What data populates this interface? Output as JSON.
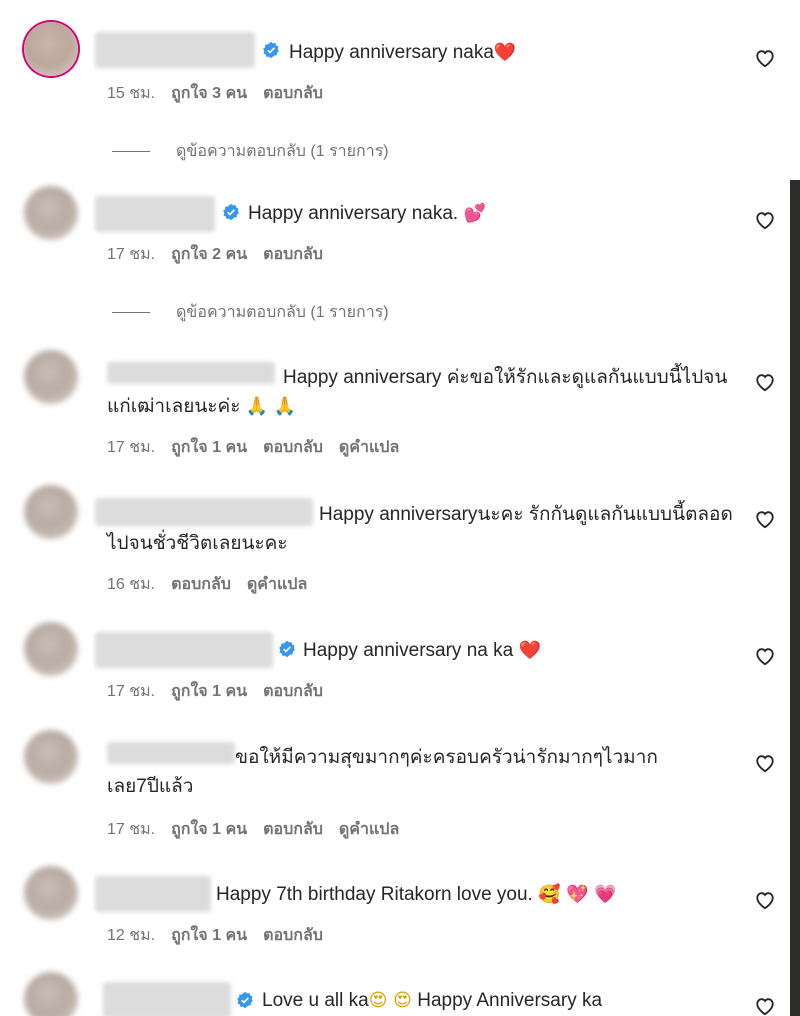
{
  "comments": [
    {
      "text": "Happy anniversary naka",
      "emoji": "❤️",
      "time": "15 ชม.",
      "likes": "ถูกใจ 3 คน",
      "reply": "ตอบกลับ",
      "view_replies": "ดูข้อความตอบกลับ (1 รายการ)"
    },
    {
      "text": "Happy anniversary naka.",
      "emoji": "💕",
      "time": "17 ชม.",
      "likes": "ถูกใจ 2 คน",
      "reply": "ตอบกลับ",
      "view_replies": "ดูข้อความตอบกลับ (1 รายการ)"
    },
    {
      "text": "Happy anniversary ค่ะขอให้รักและดูแลกันแบบนี้ไปจนแก่เฒ่าเลยนะค่ะ",
      "emoji": "🙏 🙏",
      "time": "17 ชม.",
      "likes": "ถูกใจ 1 คน",
      "reply": "ตอบกลับ",
      "translate": "ดูคำแปล"
    },
    {
      "text": "Happy anniversaryนะคะ รักกันดูแลกันแบบนี้ตลอดไปจนชั่วชีวิตเลยนะคะ",
      "time": "16 ชม.",
      "reply": "ตอบกลับ",
      "translate": "ดูคำแปล"
    },
    {
      "text": "Happy anniversary na ka",
      "emoji": "❤️",
      "time": "17 ชม.",
      "likes": "ถูกใจ 1 คน",
      "reply": "ตอบกลับ"
    },
    {
      "text": "ขอให้มีความสุขมากๆค่ะครอบครัวน่ารักมากๆไวมากเลย7ปีแล้ว",
      "time": "17 ชม.",
      "likes": "ถูกใจ 1 คน",
      "reply": "ตอบกลับ",
      "translate": "ดูคำแปล"
    },
    {
      "text": "Happy 7th birthday Ritakorn love you.",
      "emoji": "🥰 💖 💗",
      "time": "12 ชม.",
      "likes": "ถูกใจ 1 คน",
      "reply": "ตอบกลับ"
    },
    {
      "text_a": "Love u all ka",
      "emoji_a": "😍 😍",
      "text_b": "Happy Anniversary ka"
    }
  ],
  "icons": {
    "like": "heart-outline-icon",
    "verified": "verified-badge-icon"
  },
  "colors": {
    "verified": "#3797f0",
    "muted": "#737373",
    "text": "#262626"
  }
}
